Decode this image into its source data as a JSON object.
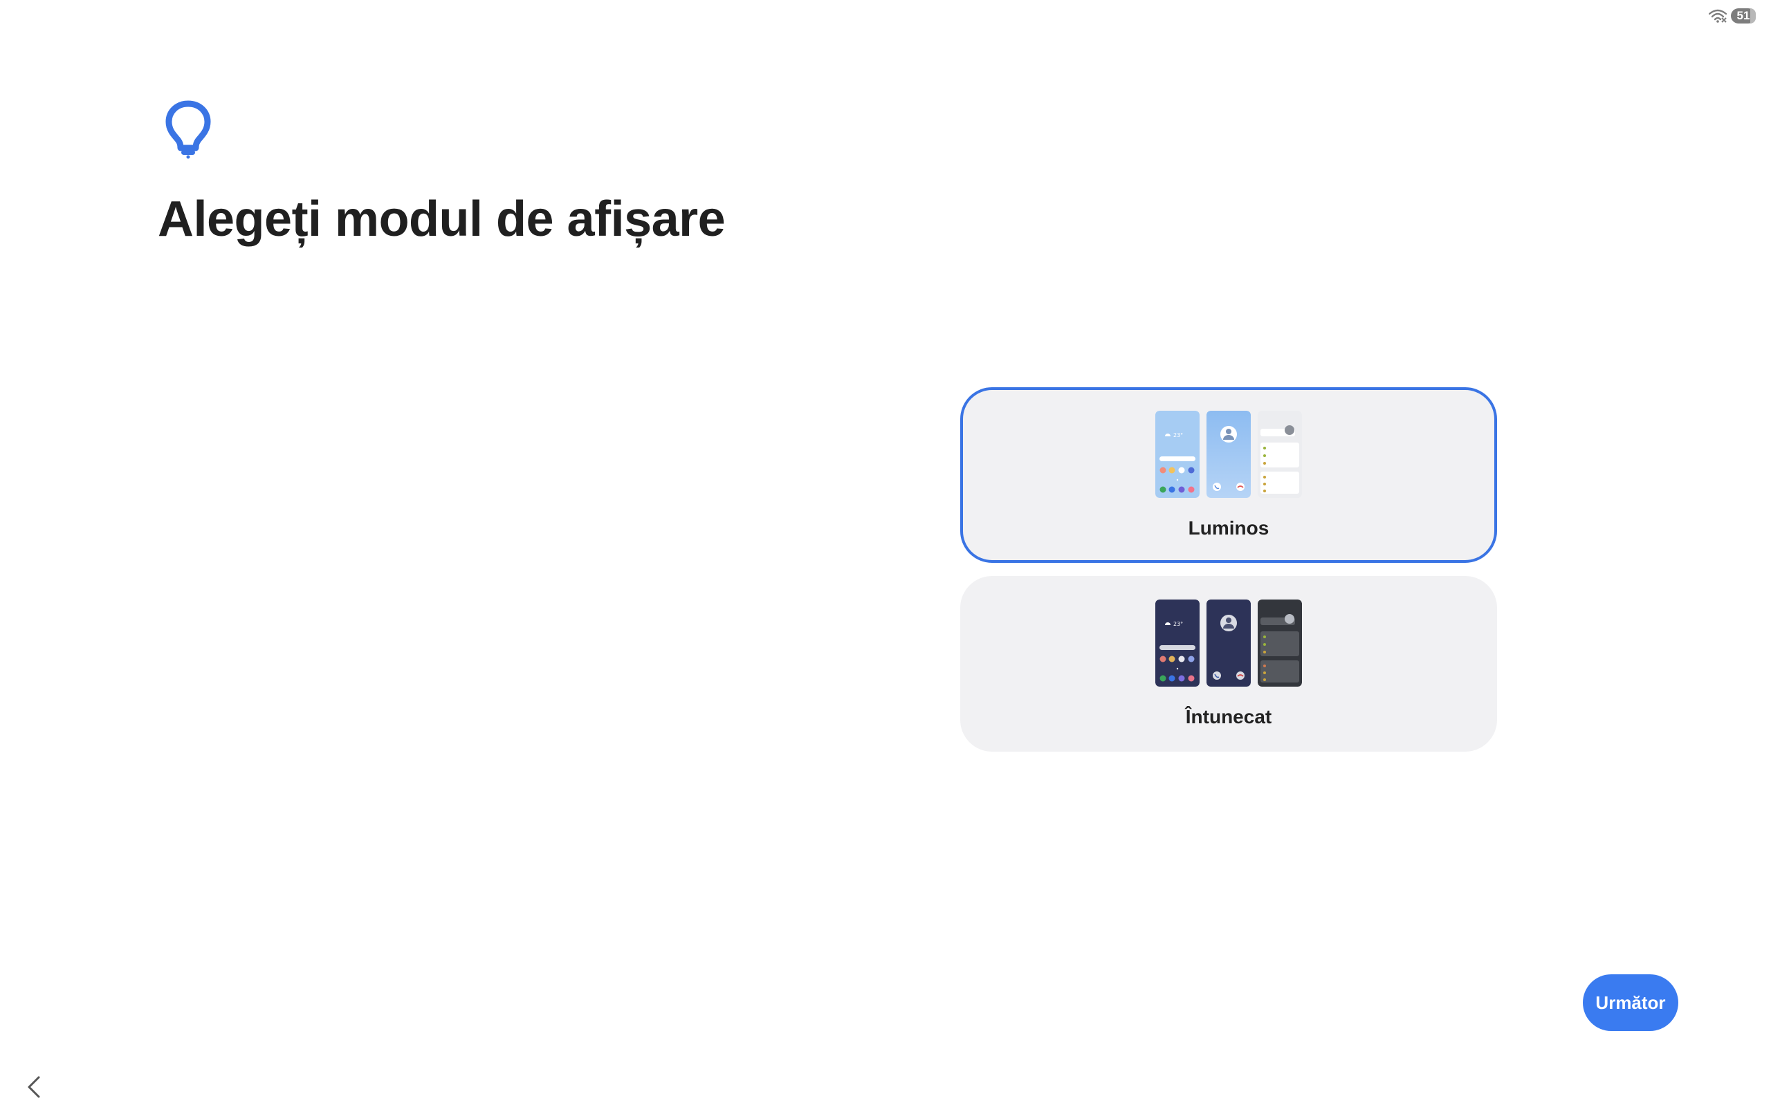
{
  "status_bar": {
    "battery_level": "51",
    "icons": [
      "wifi-icon",
      "battery-icon"
    ]
  },
  "header": {
    "icon": "lightbulb-icon",
    "title": "Alegeți modul de afișare"
  },
  "options": [
    {
      "label": "Luminos",
      "selected": true,
      "preview": {
        "weather_text": "23°",
        "colors": [
          "#a6ccf3",
          "#8fbdf0",
          "#ecedf0"
        ]
      }
    },
    {
      "label": "Întunecat",
      "selected": false,
      "preview": {
        "weather_text": "23°",
        "colors": [
          "#2d3358",
          "#2d3358",
          "#33363c"
        ]
      }
    }
  ],
  "footer": {
    "next_label": "Următor",
    "back_icon": "chevron-left-icon"
  },
  "colors": {
    "accent": "#3a7bf0",
    "selected_border": "#3a74e4",
    "card_background": "#f1f1f3"
  }
}
